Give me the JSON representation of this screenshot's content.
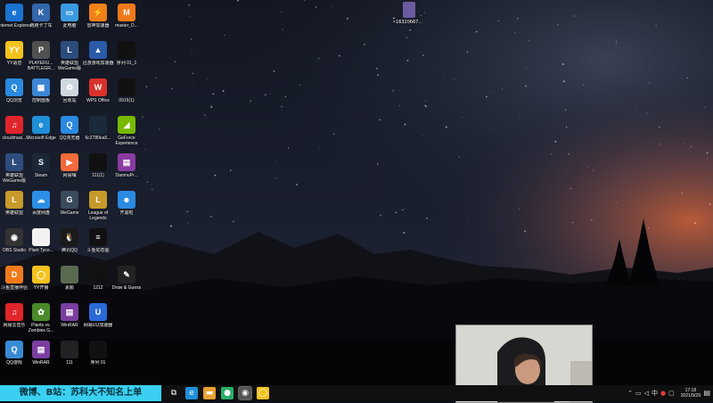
{
  "desktop": {
    "icons_col1": [
      {
        "label": "Internet Explorer",
        "icon": "internet-explorer-icon",
        "color": "#1a73d1",
        "glyph": "e"
      },
      {
        "label": "YY语音",
        "icon": "yy-voice-icon",
        "color": "#f4c21c",
        "glyph": "YY"
      },
      {
        "label": "QQ浏览",
        "icon": "qq-browser-icon",
        "color": "#2a8ae0",
        "glyph": "Q"
      },
      {
        "label": "cloudmusi...",
        "icon": "cloudmusic-icon",
        "color": "#e0252b",
        "glyph": "♫"
      },
      {
        "label": "英雄联盟 WeGame版",
        "icon": "league-wegame-icon",
        "color": "#2d4c7c",
        "glyph": "L"
      },
      {
        "label": "英雄联盟",
        "icon": "league-icon",
        "color": "#c79a2b",
        "glyph": "L"
      },
      {
        "label": "OBS Studio",
        "icon": "obs-icon",
        "color": "#333333",
        "glyph": "◉"
      },
      {
        "label": "斗鱼直播伴侣",
        "icon": "douyu-icon",
        "color": "#f07a1a",
        "glyph": "D"
      },
      {
        "label": "网易云音乐",
        "icon": "netease-music-icon",
        "color": "#e0252b",
        "glyph": "♫"
      },
      {
        "label": "QQ游戏",
        "icon": "qq-game-icon",
        "color": "#3a8ad6",
        "glyph": "Q"
      }
    ],
    "icons_col2": [
      {
        "label": "跑跑卡丁车",
        "icon": "kartrider-icon",
        "color": "#3366aa",
        "glyph": "K"
      },
      {
        "label": "PLAYERU... BATTLEGR...",
        "icon": "pubg-icon",
        "color": "#505050",
        "glyph": "P"
      },
      {
        "label": "控制面板",
        "icon": "control-panel-icon",
        "color": "#3b86d6",
        "glyph": "▦"
      },
      {
        "label": "Microsoft Edge",
        "icon": "edge-icon",
        "color": "#1f8fd8",
        "glyph": "e"
      },
      {
        "label": "Steam",
        "icon": "steam-icon",
        "color": "#1b2838",
        "glyph": "S"
      },
      {
        "label": "百度网盘",
        "icon": "baidu-netdisk-icon",
        "color": "#2c8fe6",
        "glyph": "☁"
      },
      {
        "label": "Plant Tyco...",
        "icon": "document-icon",
        "color": "#f2f2f2",
        "glyph": ""
      },
      {
        "label": "YY开播",
        "icon": "yy-live-icon",
        "color": "#f4c21c",
        "glyph": "◯"
      },
      {
        "label": "Plants vs. Zombies G...",
        "icon": "pvz-icon",
        "color": "#4a8a2a",
        "glyph": "✿"
      },
      {
        "label": "WinRAR",
        "icon": "winrar-icon",
        "color": "#7a3ea0",
        "glyph": "▤"
      }
    ],
    "icons_col3": [
      {
        "label": "此电脑",
        "icon": "this-pc-icon",
        "color": "#3a9be0",
        "glyph": "▭"
      },
      {
        "label": "英雄联盟 WeGame版",
        "icon": "league-wegame-icon",
        "color": "#2d4c7c",
        "glyph": "L"
      },
      {
        "label": "回收站",
        "icon": "recycle-bin-icon",
        "color": "#cfd8e0",
        "glyph": "♻"
      },
      {
        "label": "QQ浏览器",
        "icon": "qq-browser-icon",
        "color": "#2a8ae0",
        "glyph": "Q"
      },
      {
        "label": "网易嗨",
        "icon": "netease-icon",
        "color": "#f26b3a",
        "glyph": "▶"
      },
      {
        "label": "WeGame",
        "icon": "wegame-icon",
        "color": "#3a4a5a",
        "glyph": "G"
      },
      {
        "label": "腾讯QQ",
        "icon": "tencent-qq-icon",
        "color": "#1a1a1a",
        "glyph": "🐧"
      },
      {
        "label": "素颜",
        "icon": "image-file-icon",
        "color": "#5a6a50",
        "glyph": ""
      },
      {
        "label": "WinRAR",
        "icon": "winrar-icon",
        "color": "#7a3ea0",
        "glyph": "▤"
      },
      {
        "label": "111",
        "icon": "video-file-icon",
        "color": "#222222",
        "glyph": ""
      }
    ],
    "icons_col4": [
      {
        "label": "雷神加速器",
        "icon": "leishen-accelerator-icon",
        "color": "#f0801a",
        "glyph": "⚡"
      },
      {
        "label": "迅游游戏加速器",
        "icon": "xunyou-icon",
        "color": "#2a5aa8",
        "glyph": "▲"
      },
      {
        "label": "WPS Office",
        "icon": "wps-office-icon",
        "color": "#d9322b",
        "glyph": "W"
      },
      {
        "label": "6c2780ea5...",
        "icon": "image-file-icon",
        "color": "#1a2a3a",
        "glyph": ""
      },
      {
        "label": "111(1)",
        "icon": "video-file-icon",
        "color": "#111111",
        "glyph": ""
      },
      {
        "label": "League of Legends",
        "icon": "league-client-icon",
        "color": "#c79a2b",
        "glyph": "L"
      },
      {
        "label": "斗鱼动态图",
        "icon": "document-icon",
        "color": "#111111",
        "glyph": "≡"
      },
      {
        "label": "1212",
        "icon": "video-file-icon",
        "color": "#111111",
        "glyph": ""
      },
      {
        "label": "网易UU加速器",
        "icon": "uu-accelerator-icon",
        "color": "#2a6ad8",
        "glyph": "U"
      },
      {
        "label": "序列 01",
        "icon": "video-file-icon",
        "color": "#111111",
        "glyph": ""
      }
    ],
    "icons_col5": [
      {
        "label": "master_D...",
        "icon": "master-icon",
        "color": "#f07a1a",
        "glyph": "M"
      },
      {
        "label": "序列 01_1",
        "icon": "video-file-icon",
        "color": "#111111",
        "glyph": ""
      },
      {
        "label": "0916(1)",
        "icon": "video-file-icon",
        "color": "#111111",
        "glyph": ""
      },
      {
        "label": "GeForce Experience",
        "icon": "geforce-icon",
        "color": "#76b900",
        "glyph": "◢"
      },
      {
        "label": "DanmuPr...",
        "icon": "danmu-icon",
        "color": "#8a3aa0",
        "glyph": "▤"
      },
      {
        "label": "开黑啦",
        "icon": "kaiheila-icon",
        "color": "#2a8ae0",
        "glyph": "☻"
      },
      {
        "label": "",
        "icon": "blank-icon",
        "color": "transparent",
        "glyph": ""
      },
      {
        "label": "Draw & Guess",
        "icon": "draw-guess-icon",
        "color": "#222222",
        "glyph": "✎"
      },
      {
        "label": "",
        "icon": "blank-icon",
        "color": "transparent",
        "glyph": ""
      },
      {
        "label": "",
        "icon": "blank-icon",
        "color": "transparent",
        "glyph": ""
      }
    ],
    "stray_file": {
      "label": "16320667...",
      "icon": "file-icon",
      "color": "#6a5aa0"
    }
  },
  "taskbar": {
    "banner_text": "微博、B站：苏科大不知名上单",
    "apps": [
      {
        "icon": "task-view-icon",
        "glyph": "⧉",
        "color": "#101010"
      },
      {
        "icon": "edge-icon",
        "glyph": "e",
        "color": "#1f8fd8"
      },
      {
        "icon": "file-explorer-icon",
        "glyph": "▬",
        "color": "#e8a030"
      },
      {
        "icon": "wechat-icon",
        "glyph": "●",
        "color": "#2aae67"
      },
      {
        "icon": "obs-icon",
        "glyph": "◉",
        "color": "#555555"
      },
      {
        "icon": "yy-live-icon",
        "glyph": "◯",
        "color": "#f4c21c"
      }
    ],
    "tray": {
      "icons": [
        "chevron-up-icon",
        "network-icon",
        "volume-icon",
        "ime-icon",
        "antivirus-icon",
        "chat-icon"
      ],
      "time": "17:18",
      "date": "2021/9/29"
    }
  },
  "webcam": {
    "label": "webcam-overlay"
  }
}
